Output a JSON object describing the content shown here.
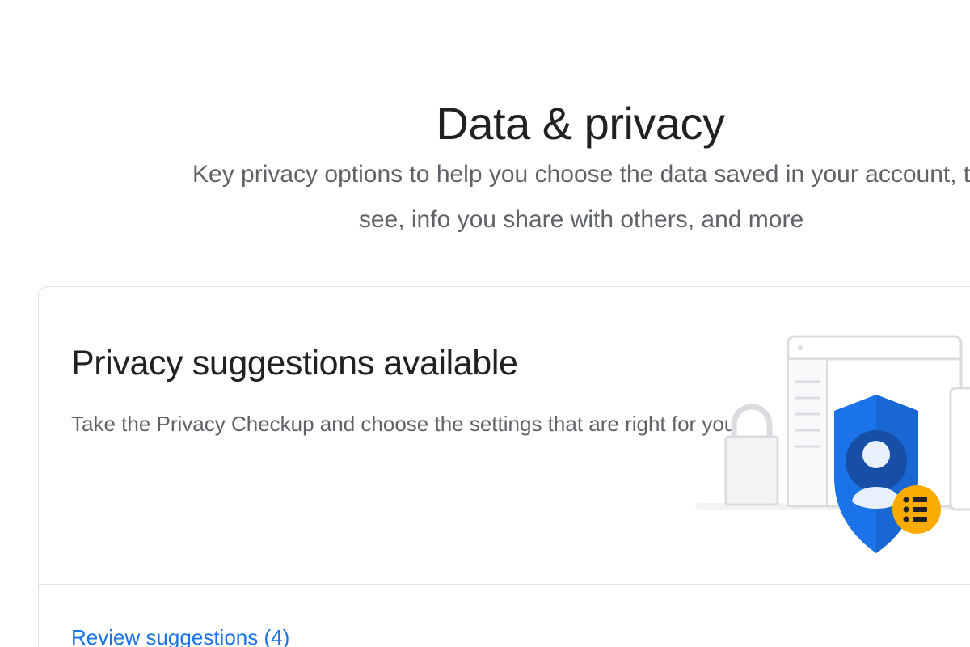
{
  "header": {
    "title": "Data & privacy",
    "subtitle_line1": "Key privacy options to help you choose the data saved in your account, the ads you",
    "subtitle_line2": "see, info you share with others, and more"
  },
  "privacy_card": {
    "title": "Privacy suggestions available",
    "description": "Take the Privacy Checkup and choose the settings that are right for you",
    "review_link": "Review suggestions (4)",
    "illustration_icons": [
      "lock-icon",
      "browser-window-icon",
      "shield-person-icon",
      "list-badge-icon"
    ]
  },
  "colors": {
    "link": "#1a73e8",
    "shield_blue": "#1a73e8",
    "badge_yellow": "#f9ab00",
    "text_primary": "#202124",
    "text_secondary": "#5f6368"
  }
}
